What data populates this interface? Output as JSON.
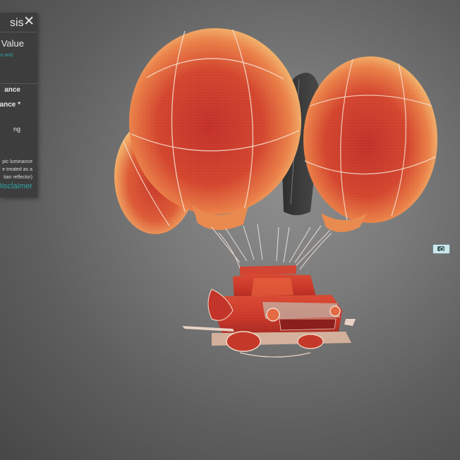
{
  "panel": {
    "title": "sis",
    "close": "✕",
    "mode_label": "Value",
    "mode_sub": "e and",
    "option_1": "ance",
    "option_2": "ance *",
    "option_3": "ng",
    "note_line_1": "pic luminance",
    "note_line_2": "e treated as a",
    "note_line_3": "tian reflector)",
    "disclaimer": "Disclaimer"
  },
  "colors": {
    "balloon_hot": "#cc3a2c",
    "balloon_mid": "#f0a760",
    "balloon_cool": "#b8e0cc",
    "background": "#7a7a7a",
    "accent": "#2fa3a6"
  },
  "icons": {
    "camera": "camera-icon",
    "close": "close-icon"
  }
}
